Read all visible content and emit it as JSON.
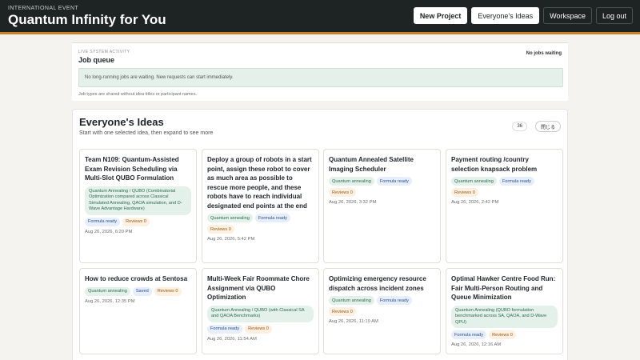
{
  "header": {
    "eyebrow": "INTERNATIONAL EVENT",
    "title": "Quantum Infinity for You",
    "nav": [
      "New Project",
      "Everyone's Ideas",
      "Workspace",
      "Log out"
    ]
  },
  "queue": {
    "eyebrow": "LIVE SYSTEM ACTIVITY",
    "title": "Job queue",
    "status": "No jobs waiting",
    "message": "No long-running jobs are waiting. New requests can start immediately.",
    "note": "Job types are shared without idea titles or participant names."
  },
  "ideas": {
    "title": "Everyone's Ideas",
    "subtitle": "Start with one selected idea, then expand to see more",
    "count": "36",
    "close_label": "閉じる",
    "cards": [
      {
        "title": "Team N109: Quantum-Assisted Exam Revision Scheduling via Multi-Slot QUBO Formulation",
        "tags": [
          "Quantum Annealing / QUBO (Combinatorial Optimization compared across Classical Simulated Annealing, QAOA simulation, and D-Wave Advantage Hardware)",
          "Formula ready",
          "Reviews 0"
        ],
        "date": "Aug 26, 2026, 6:20 PM"
      },
      {
        "title": "Deploy a group of robots in a start point, assign these robot to cover as much area as possible to rescue more people, and these robots have to reach individual designated end points at the end",
        "tags": [
          "Quantum annealing",
          "Formula ready",
          "Reviews 0"
        ],
        "date": "Aug 26, 2026, 5:42 PM"
      },
      {
        "title": "Quantum Annealed Satellite Imaging Scheduler",
        "tags": [
          "Quantum annealing",
          "Formula ready",
          "Reviews 0"
        ],
        "date": "Aug 26, 2026, 3:32 PM"
      },
      {
        "title": "Payment routing /country selection knapsack problem",
        "tags": [
          "Quantum annealing",
          "Formula ready",
          "Reviews 0"
        ],
        "date": "Aug 26, 2026, 2:42 PM"
      },
      {
        "title": "How to reduce crowds at Sentosa",
        "tags": [
          "Quantum annealing",
          "Saved",
          "Reviews 0"
        ],
        "date": "Aug 26, 2026, 12:35 PM"
      },
      {
        "title": "Multi-Week Fair Roommate Chore Assignment via QUBO Optimization",
        "tags": [
          "Quantum Annealing / QUBO (with Classical SA and QAOA Benchmarks)",
          "Formula ready",
          "Reviews 0"
        ],
        "date": "Aug 26, 2026, 11:54 AM"
      },
      {
        "title": "Optimizing emergency resource dispatch across incident zones",
        "tags": [
          "Quantum annealing",
          "Formula ready",
          "Reviews 0"
        ],
        "date": "Aug 26, 2026, 11:19 AM"
      },
      {
        "title": "Optimal Hawker Centre Food Run: Fair Multi-Person Routing and Queue Minimization",
        "tags": [
          "Quantum Annealing (QUBO formulation benchmarked across SA, QAOA, and D-Wave QPU)",
          "Formula ready",
          "Reviews 0"
        ],
        "date": "Aug 26, 2026, 12:16 AM"
      }
    ]
  }
}
